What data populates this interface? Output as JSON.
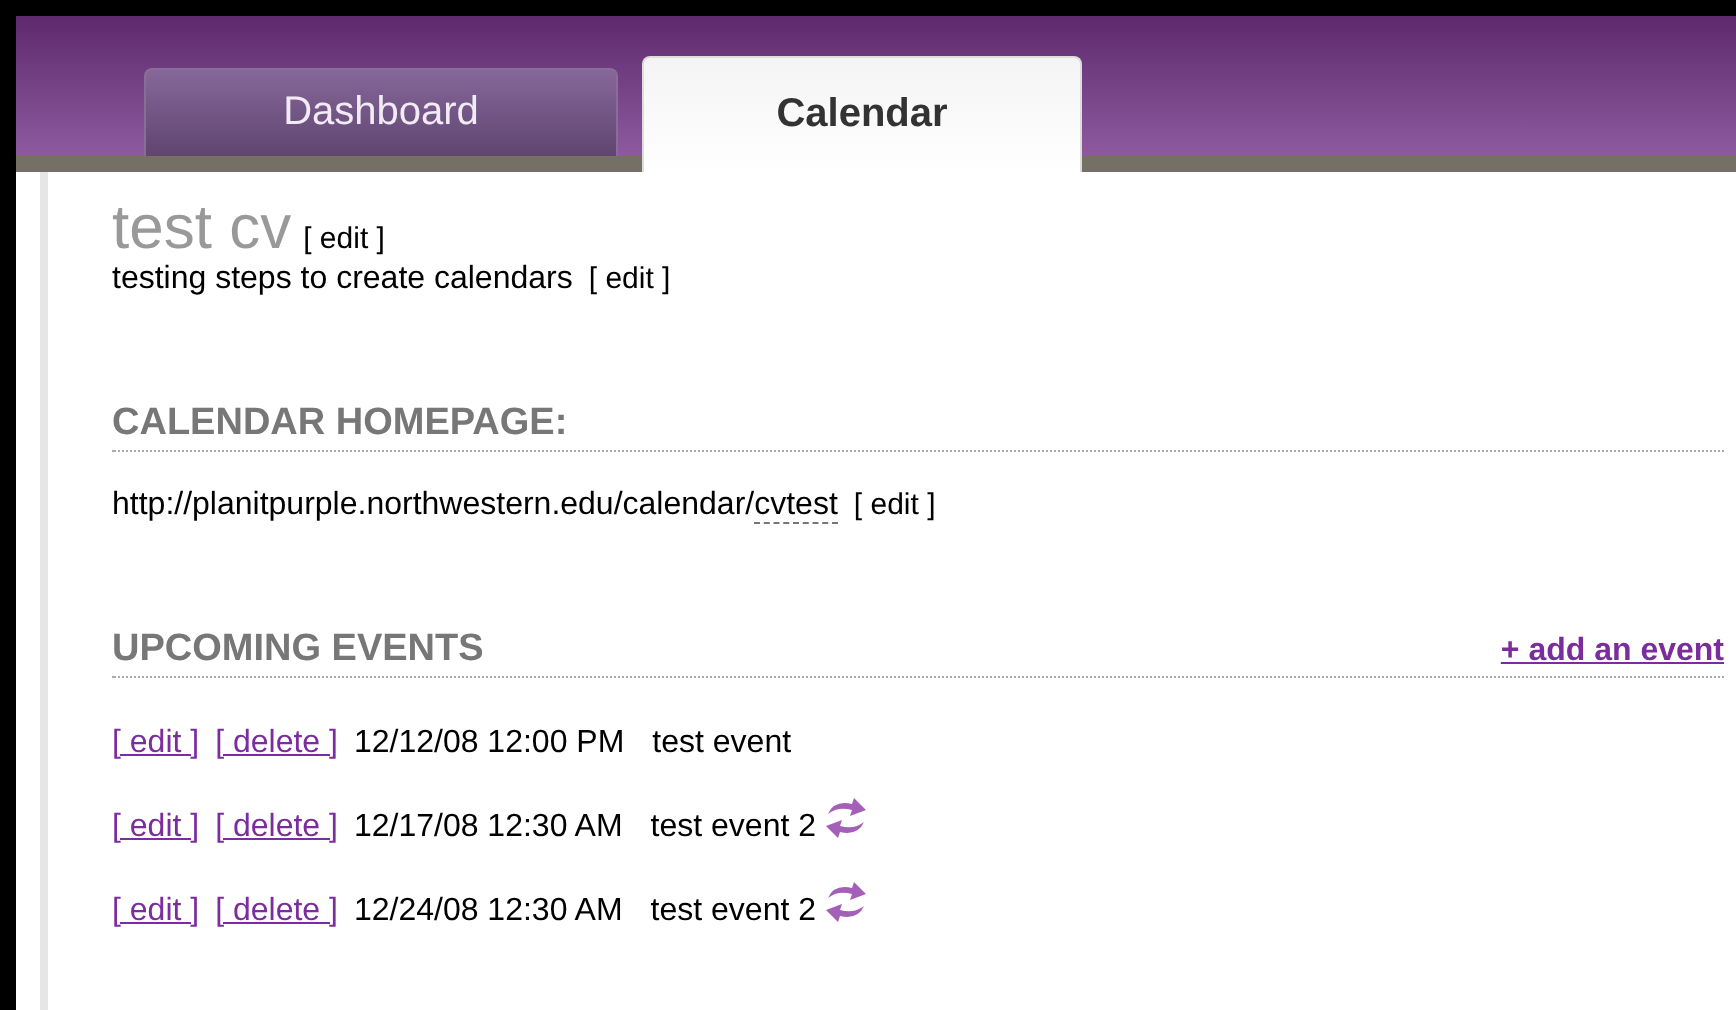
{
  "tabs": [
    {
      "label": "Dashboard",
      "selected": false
    },
    {
      "label": "Calendar",
      "selected": true
    }
  ],
  "calendar": {
    "title": "test cv",
    "title_edit": "[ edit ]",
    "description": "testing steps to create calendars",
    "description_edit": "[ edit ]"
  },
  "homepage": {
    "heading": "CALENDAR HOMEPAGE:",
    "url_base": "http://planitpurple.northwestern.edu/calendar/",
    "url_slug": "cvtest",
    "edit": "[ edit ]"
  },
  "upcoming": {
    "heading": "UPCOMING EVENTS",
    "add_link": "+ add an event",
    "events": [
      {
        "edit": "[ edit ]",
        "delete": "[ delete ]",
        "datetime": "12/12/08 12:00 PM",
        "name": "test event",
        "recurring": false
      },
      {
        "edit": "[ edit ]",
        "delete": "[ delete ]",
        "datetime": "12/17/08 12:30 AM",
        "name": "test event 2",
        "recurring": true
      },
      {
        "edit": "[ edit ]",
        "delete": "[ delete ]",
        "datetime": "12/24/08 12:30 AM",
        "name": "test event 2",
        "recurring": true
      }
    ]
  }
}
